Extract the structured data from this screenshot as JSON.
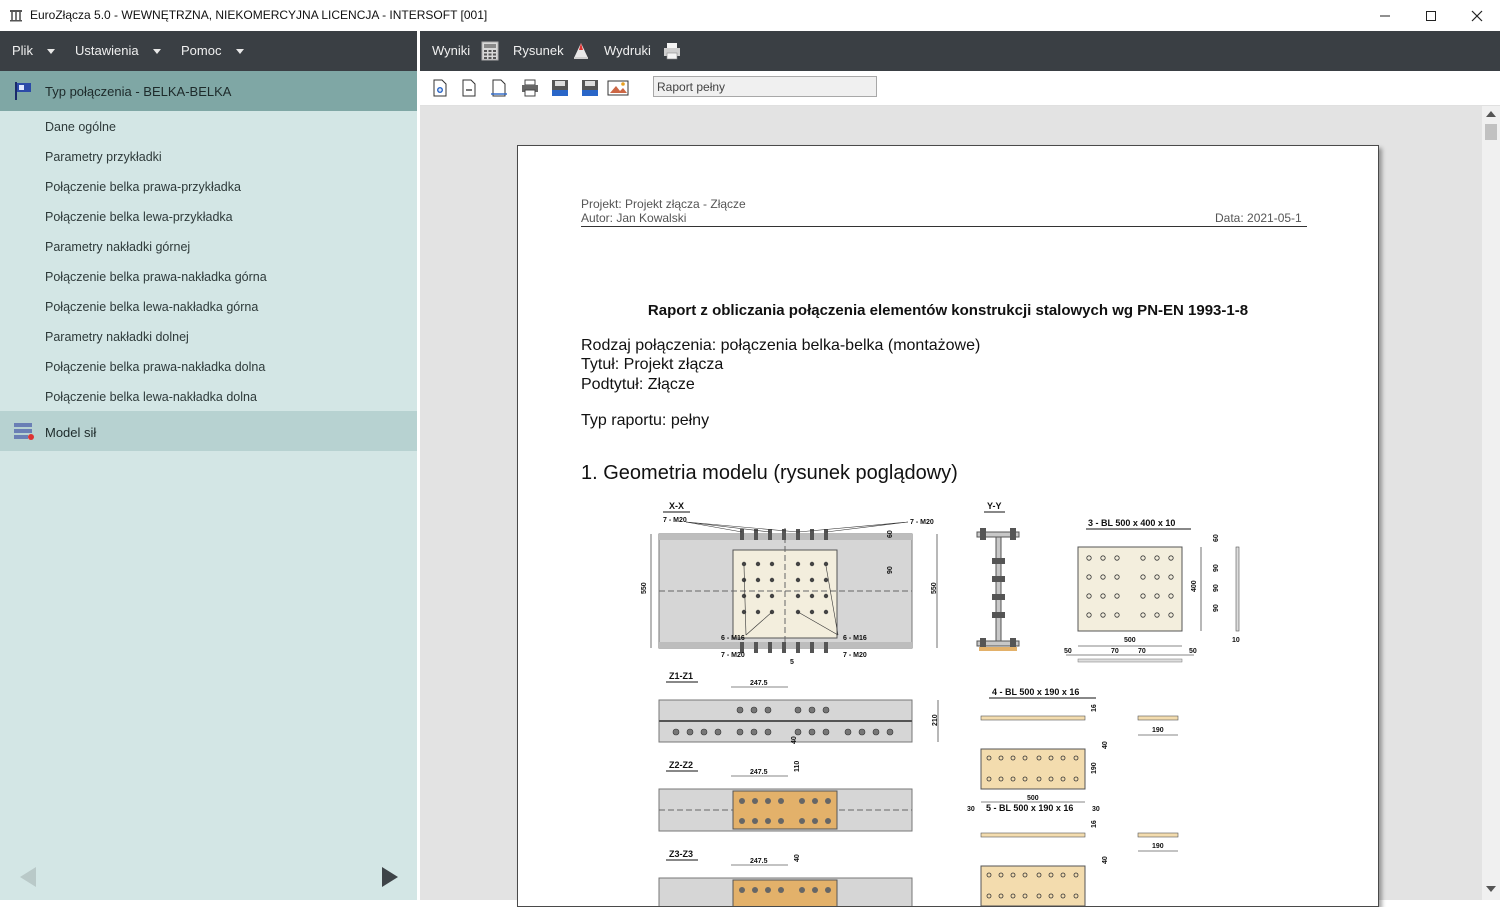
{
  "window": {
    "title": "EuroZłącza 5.0 - WEWNĘTRZNA, NIEKOMERCYJNA LICENCJA - INTERSOFT [001]"
  },
  "menu": {
    "file": "Plik",
    "settings": "Ustawienia",
    "help": "Pomoc"
  },
  "toolbar": {
    "results": "Wyniki",
    "drawing": "Rysunek",
    "printouts": "Wydruki"
  },
  "sidebar": {
    "header": "Typ połączenia - BELKA-BELKA",
    "items": [
      {
        "label": "Dane ogólne"
      },
      {
        "label": "Parametry przykładki"
      },
      {
        "label": "Połączenie belka prawa-przykładka"
      },
      {
        "label": "Połączenie belka lewa-przykładka"
      },
      {
        "label": "Parametry nakładki górnej"
      },
      {
        "label": "Połączenie belka prawa-nakładka górna"
      },
      {
        "label": "Połączenie belka lewa-nakładka górna"
      },
      {
        "label": "Parametry nakładki dolnej"
      },
      {
        "label": "Połączenie belka prawa-nakładka dolna"
      },
      {
        "label": "Połączenie belka lewa-nakładka dolna"
      }
    ],
    "model": "Model sił"
  },
  "viewer": {
    "report_type_field": "Raport pełny"
  },
  "report": {
    "project": "Projekt: Projekt złącza - Złącze",
    "author": "Autor: Jan Kowalski",
    "date": "Data: 2021-05-1",
    "title": "Raport z obliczania połączenia elementów konstrukcji stalowych wg PN-EN 1993-1-8",
    "connection_type": "Rodzaj połączenia: połączenia belka-belka (montażowe)",
    "title_line": "Tytuł:  Projekt złącza",
    "subtitle_line": "Podtytuł: Złącze",
    "report_type": "Typ raportu: pełny",
    "section1": "1. Geometria modelu (rysunek poglądowy)"
  },
  "drawing": {
    "xx": "X-X",
    "yy": "Y-Y",
    "z1": "Z1-Z1",
    "z2": "Z2-Z2",
    "z3": "Z3-Z3",
    "bolts_m20": "7 - M20",
    "bolts_m16": "6 - M16",
    "plate3": "3 - BL 500 x 400 x 10",
    "plate4": "4 - BL 500 x 190 x 16",
    "plate5": "5 - BL 500 x 190 x 16",
    "dim_550": "550",
    "dim_2475": "247.5",
    "dim_210": "210",
    "dim_500": "500",
    "dim_190": "190",
    "dim_400": "400",
    "dim_10": "10",
    "dim_90": "90",
    "dim_60": "60",
    "dim_50": "50",
    "dim_70": "70",
    "dim_30": "30",
    "dim_40": "40",
    "dim_5": "5",
    "dim_16": "16",
    "dim_110": "110"
  }
}
